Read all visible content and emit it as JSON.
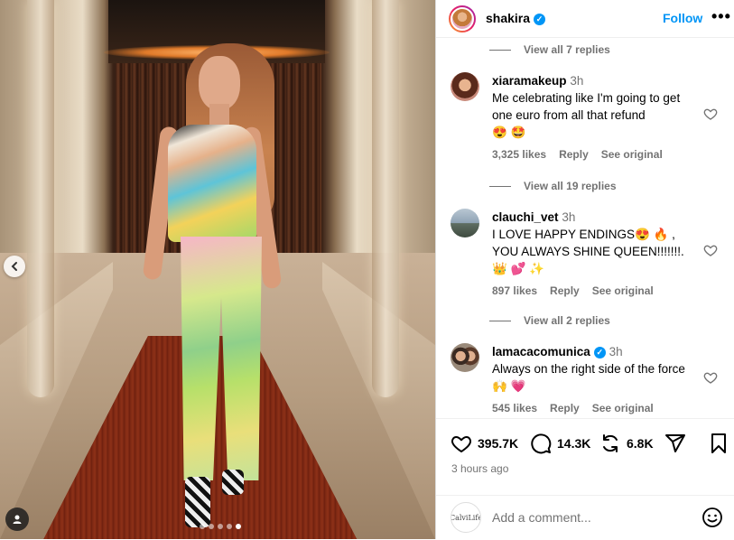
{
  "post": {
    "carousel": {
      "count": 5,
      "active_index": 4
    }
  },
  "header": {
    "username": "shakira",
    "follow_label": "Follow",
    "more_icon": "more-horizontal-icon"
  },
  "comments": {
    "view_replies_top": "View all 7 replies",
    "items": [
      {
        "username": "xiaramakeup",
        "time": "3h",
        "verified": false,
        "text": "Me celebrating like I'm going to get one euro from all that refund",
        "emoji": "😍 🤩",
        "likes": "3,325 likes",
        "reply_label": "Reply",
        "see_original_label": "See original",
        "view_replies": "View all 19 replies"
      },
      {
        "username": "clauchi_vet",
        "time": "3h",
        "verified": false,
        "text_line1": "I LOVE HAPPY ENDINGS😍 🔥 ,",
        "text_line2": "YOU ALWAYS SHINE QUEEN!!!!!!!.",
        "emoji": "👑 💕 ✨",
        "likes": "897 likes",
        "reply_label": "Reply",
        "see_original_label": "See original",
        "view_replies": "View all 2 replies"
      },
      {
        "username": "lamacacomunica",
        "time": "3h",
        "verified": true,
        "text": "Always on the right side of the force 🙌 💗",
        "likes": "545 likes",
        "reply_label": "Reply",
        "see_original_label": "See original"
      }
    ]
  },
  "actions": {
    "likes": "395.7K",
    "comments": "14.3K",
    "reposts": "6.8K",
    "time_ago": "3 hours ago"
  },
  "add_comment": {
    "placeholder": "Add a comment...",
    "avatar_text": "CalviLife"
  },
  "colors": {
    "accent": "#0095f6",
    "muted": "#737373"
  }
}
